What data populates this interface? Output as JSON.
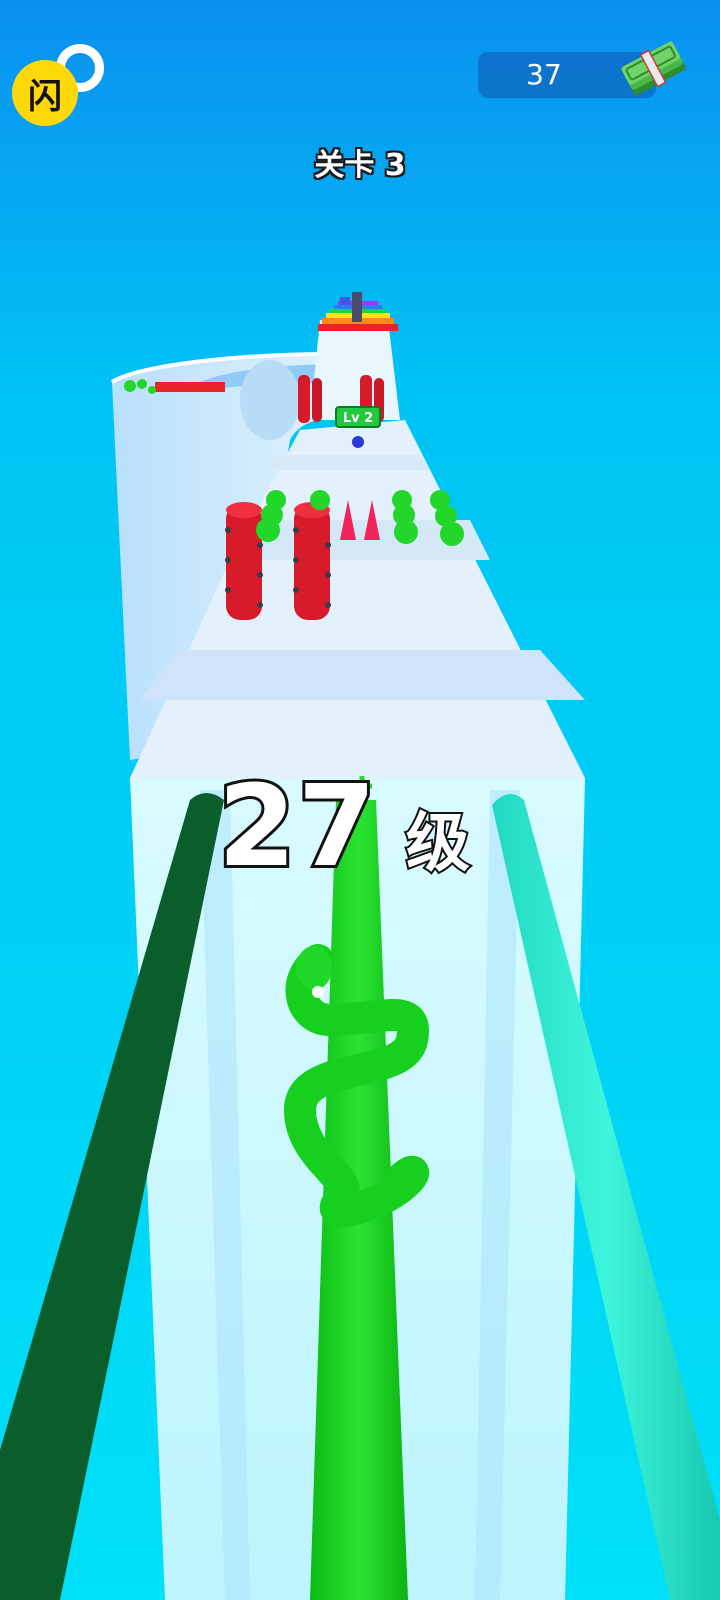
{
  "hud": {
    "logo_char": "闪",
    "coins": "37",
    "level_title": "关卡 3"
  },
  "player": {
    "level_number": "27",
    "level_unit": "级"
  },
  "track": {
    "gate_label": "Lv 2"
  },
  "colors": {
    "sky_top": "#0a8ff0",
    "sky_bottom": "#00e0f8",
    "track": "#dff2fb",
    "track_side": "#c9f6fd",
    "snake_green": "#16cf1c",
    "pole_dark_green": "#0a5e2c",
    "pole_teal": "#28e6cc",
    "spike_red": "#d81b2a",
    "ball_green": "#22d62a",
    "logo_yellow": "#ffd80a"
  },
  "icons": [
    "app-logo-icon",
    "cash-stack-icon"
  ]
}
